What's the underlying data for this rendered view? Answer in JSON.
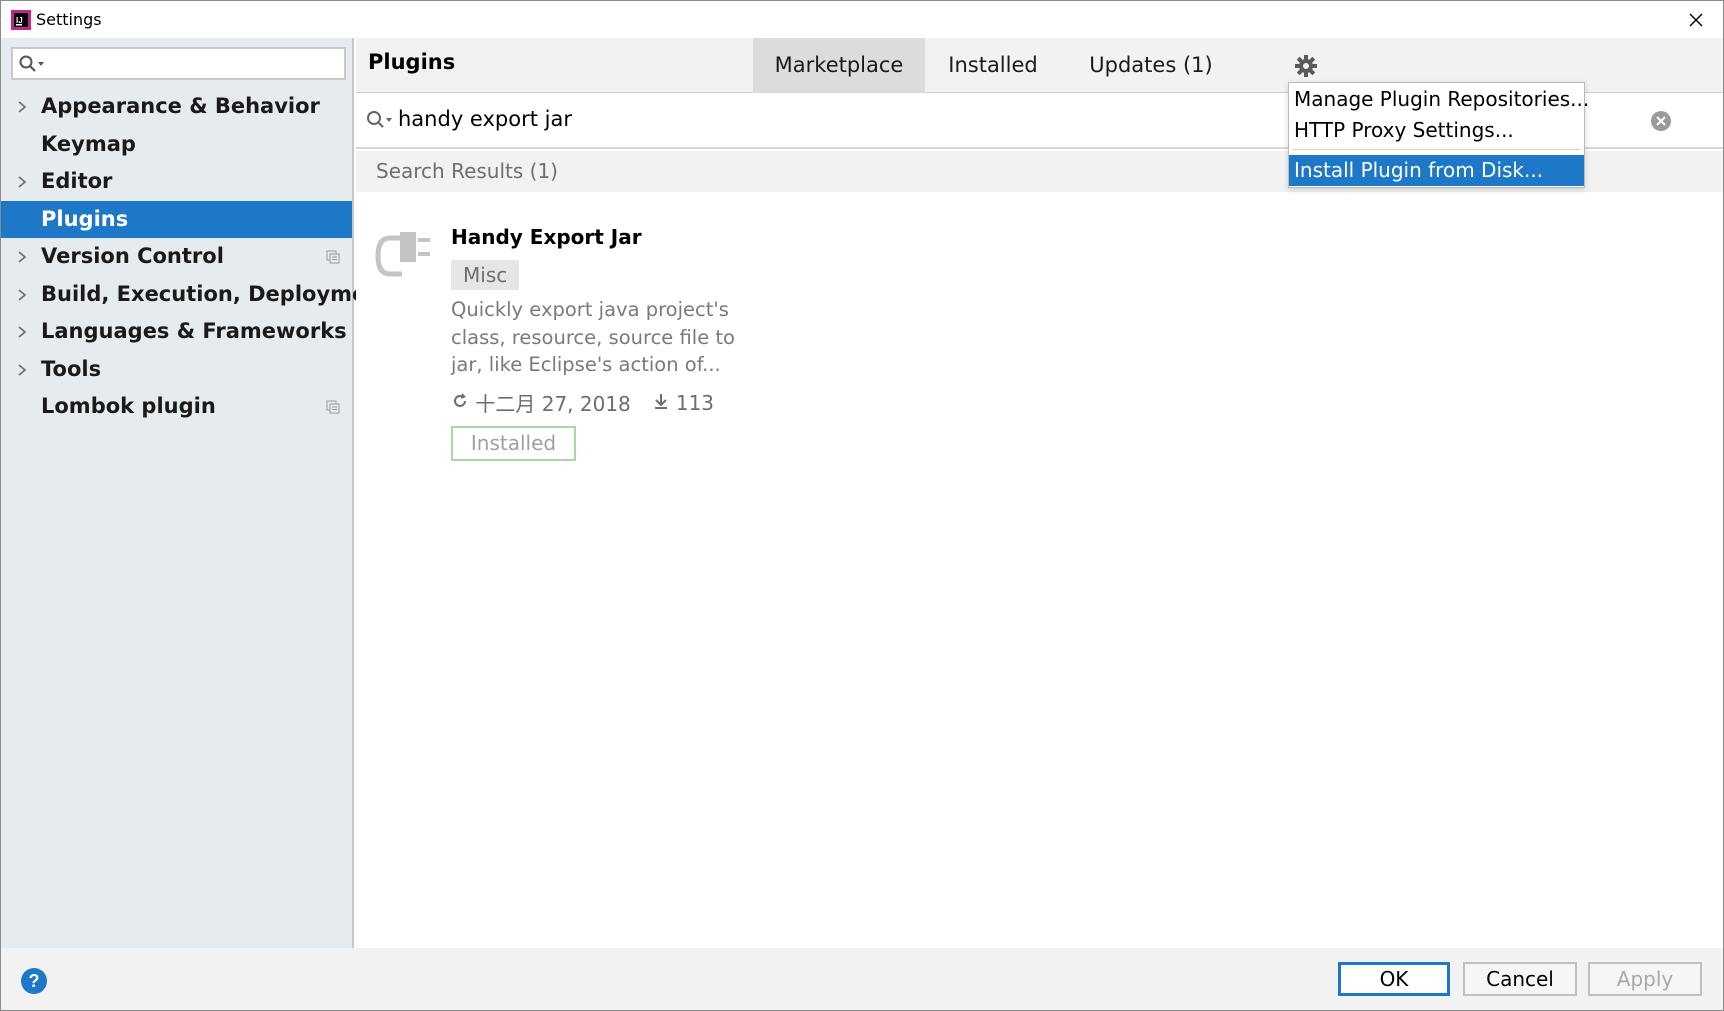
{
  "window": {
    "title": "Settings",
    "app_icon": "intellij-icon",
    "close_icon": "close-icon"
  },
  "sidebar": {
    "search": {
      "value": "",
      "icon": "search-icon"
    },
    "items": [
      {
        "label": "Appearance & Behavior",
        "expandable": true,
        "selected": false,
        "project_icon": false
      },
      {
        "label": "Keymap",
        "expandable": false,
        "selected": false,
        "project_icon": false
      },
      {
        "label": "Editor",
        "expandable": true,
        "selected": false,
        "project_icon": false
      },
      {
        "label": "Plugins",
        "expandable": false,
        "selected": true,
        "project_icon": false
      },
      {
        "label": "Version Control",
        "expandable": true,
        "selected": false,
        "project_icon": true
      },
      {
        "label": "Build, Execution, Deployment",
        "expandable": true,
        "selected": false,
        "project_icon": false
      },
      {
        "label": "Languages & Frameworks",
        "expandable": true,
        "selected": false,
        "project_icon": false
      },
      {
        "label": "Tools",
        "expandable": true,
        "selected": false,
        "project_icon": false
      },
      {
        "label": "Lombok plugin",
        "expandable": false,
        "selected": false,
        "project_icon": true
      }
    ]
  },
  "header": {
    "title": "Plugins",
    "tabs": [
      {
        "label": "Marketplace",
        "active": true
      },
      {
        "label": "Installed",
        "active": false
      },
      {
        "label": "Updates (1)",
        "active": false
      }
    ],
    "gear_icon": "gear-icon"
  },
  "search": {
    "value": "handy export jar",
    "icon": "search-icon",
    "clear_icon": "clear-icon"
  },
  "results": {
    "label": "Search Results (1)"
  },
  "plugin": {
    "name": "Handy Export Jar",
    "tag": "Misc",
    "description": "Quickly export java project's class, resource, source file to jar, like Eclipse's action of...",
    "date": "十二月 27, 2018",
    "downloads": "113",
    "status_button": "Installed",
    "icon": "plugin-plug-icon"
  },
  "dropdown": {
    "items": [
      {
        "label": "Manage Plugin Repositories...",
        "highlighted": false
      },
      {
        "label": "HTTP Proxy Settings...",
        "highlighted": false
      },
      {
        "label": "Install Plugin from Disk...",
        "highlighted": true
      }
    ]
  },
  "footer": {
    "help_label": "?",
    "ok_label": "OK",
    "cancel_label": "Cancel",
    "apply_label": "Apply"
  },
  "colors": {
    "accent": "#1e78c8",
    "sidebar_bg": "#e6ebf0",
    "installed_border": "#a8d8a8"
  }
}
